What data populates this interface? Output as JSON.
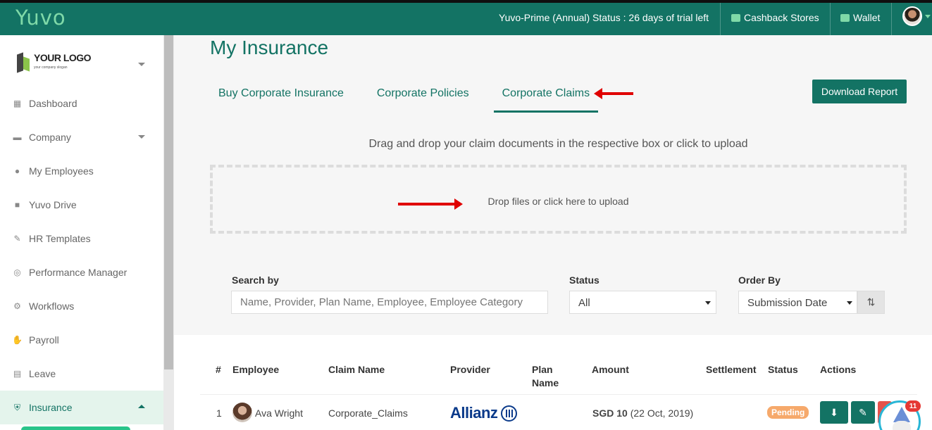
{
  "topbar": {
    "brand": "Yuvo",
    "status_text": "Yuvo-Prime (Annual) Status : 26 days of trial left",
    "cashback_label": "Cashback Stores",
    "wallet_label": "Wallet",
    "cashback_icon": "coins-icon",
    "wallet_icon": "wallet-icon"
  },
  "sidebar": {
    "logo": {
      "text": "YOUR LOGO",
      "slogan": "your company slogan"
    },
    "items": [
      {
        "label": "Dashboard",
        "icon": "grid-icon"
      },
      {
        "label": "Company",
        "icon": "archive-icon"
      },
      {
        "label": "My Employees",
        "icon": "users-icon"
      },
      {
        "label": "Yuvo Drive",
        "icon": "folder-icon"
      },
      {
        "label": "HR Templates",
        "icon": "edit-icon"
      },
      {
        "label": "Performance Manager",
        "icon": "target-icon"
      },
      {
        "label": "Workflows",
        "icon": "cogs-icon"
      },
      {
        "label": "Payroll",
        "icon": "hand-coin-icon"
      },
      {
        "label": "Leave",
        "icon": "calendar-icon"
      },
      {
        "label": "Insurance",
        "icon": "shield-icon"
      }
    ],
    "active_item": "Insurance"
  },
  "main": {
    "title": "My Insurance",
    "tabs": [
      {
        "label": "Buy Corporate Insurance"
      },
      {
        "label": "Corporate Policies"
      },
      {
        "label": "Corporate Claims"
      }
    ],
    "active_tab": "Corporate Claims",
    "download_label": "Download Report",
    "upload_hint": "Drag and drop your claim documents in the respective box or click to upload",
    "dropzone_text": "Drop files or click here to upload"
  },
  "filters": {
    "search_label": "Search by",
    "search_placeholder": "Name, Provider, Plan Name, Employee, Employee Category",
    "status_label": "Status",
    "status_value": "All",
    "order_label": "Order By",
    "order_value": "Submission Date"
  },
  "table": {
    "headers": {
      "num": "#",
      "employee": "Employee",
      "claim_name": "Claim Name",
      "provider": "Provider",
      "plan_name": "Plan Name",
      "amount": "Amount",
      "settlement": "Settlement",
      "status": "Status",
      "actions": "Actions"
    },
    "rows": [
      {
        "num": "1",
        "employee": "Ava Wright",
        "claim_name": "Corporate_Claims",
        "provider": "Allianz",
        "plan_name": "",
        "amount": "SGD 10",
        "amount_date": "(22 Oct, 2019)",
        "settlement": "",
        "status": "Pending"
      }
    ]
  },
  "helper_badge": "11",
  "colors": {
    "primary": "#137364",
    "brand_logo": "#7fd9a8",
    "pending": "#f6a96b",
    "annotation_arrow": "#e00000"
  }
}
